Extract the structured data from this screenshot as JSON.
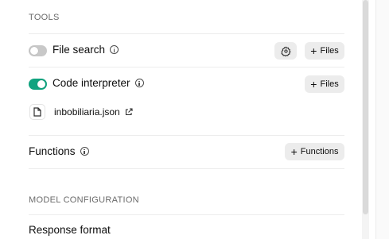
{
  "tools": {
    "section_title": "TOOLS",
    "file_search": {
      "label": "File search",
      "enabled": false,
      "files_button": "Files"
    },
    "code_interpreter": {
      "label": "Code interpreter",
      "enabled": true,
      "files_button": "Files",
      "file": "inbobiliaria.json"
    },
    "functions": {
      "label": "Functions",
      "button": "Functions"
    }
  },
  "model_configuration": {
    "section_title": "MODEL CONFIGURATION",
    "response_format_label": "Response format"
  },
  "colors": {
    "toggle_on": "#10a37f",
    "toggle_off": "#c8c8c8",
    "button_bg": "#ececec"
  },
  "icons": [
    "info-icon",
    "gear-icon",
    "plus-icon",
    "file-icon",
    "external-link-icon"
  ]
}
